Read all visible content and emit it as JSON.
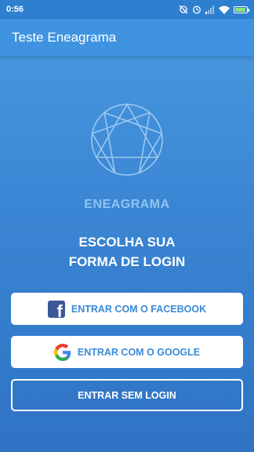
{
  "status_bar": {
    "time": "0:56",
    "icons": [
      "sync-off-icon",
      "alarm-icon",
      "signal-icon",
      "wifi-icon",
      "battery-charging-icon"
    ]
  },
  "app_bar": {
    "title": "Teste Eneagrama"
  },
  "logo": {
    "icon": "enneagram-icon"
  },
  "brand": {
    "name": "ENEAGRAMA"
  },
  "heading": {
    "line1": "ESCOLHA SUA",
    "line2": "FORMA DE LOGIN"
  },
  "buttons": {
    "facebook": {
      "label": "ENTRAR COM O FACEBOOK",
      "icon": "facebook-icon"
    },
    "google": {
      "label": "ENTRAR COM O GOOGLE",
      "icon": "google-icon"
    },
    "skip": {
      "label": "ENTRAR SEM LOGIN"
    }
  },
  "colors": {
    "background_top": "#4a9be0",
    "background_bottom": "#2f73c4",
    "app_bar": "#3f93e0",
    "button_text": "#3a8ad6",
    "brand_text": "#8fc4f0",
    "facebook_blue": "#3b5998"
  }
}
